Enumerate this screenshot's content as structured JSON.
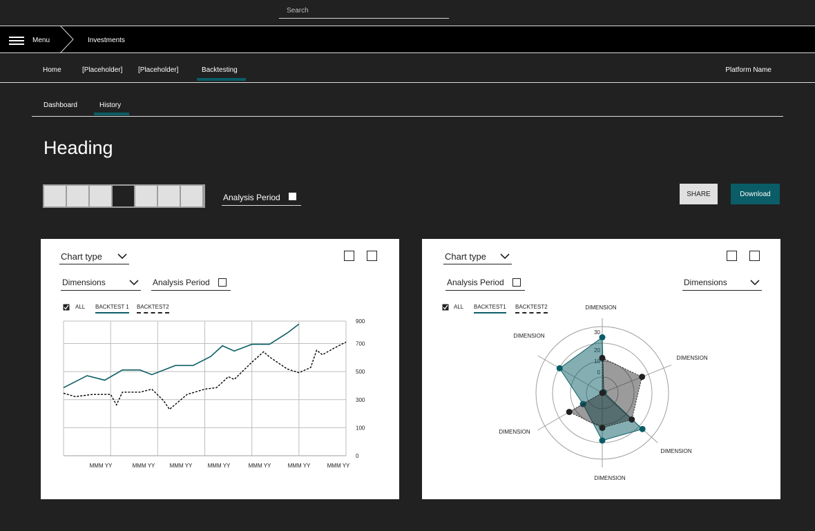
{
  "search": {
    "placeholder": "Search"
  },
  "menubar": {
    "menu_label": "Menu",
    "breadcrumb": "Investments"
  },
  "topnav": {
    "items": [
      "Home",
      "[Placeholder]",
      "[Placeholder]",
      "Backtesting"
    ],
    "active": "Backtesting",
    "platform": "Platform Name"
  },
  "subtabs": {
    "items": [
      "Dashboard",
      "History"
    ],
    "active": "History"
  },
  "page": {
    "heading": "Heading"
  },
  "controls": {
    "segments": 7,
    "selected_segment": 4,
    "analysis_period": "Analysis Period",
    "share": "SHARE",
    "download": "Download"
  },
  "colors": {
    "accent": "#0a5d66",
    "background": "#212121"
  },
  "card1": {
    "chart_type": "Chart type",
    "dimensions": "Dimensions",
    "analysis_period": "Analysis Period",
    "legend": {
      "all": "ALL",
      "series1": "BACKTEST 1",
      "series2": "BACKTEST2"
    }
  },
  "card2": {
    "chart_type": "Chart type",
    "dimensions": "Dimensions",
    "analysis_period": "Analysis Period",
    "legend": {
      "all": "ALL",
      "series1": "BACKTEST1",
      "series2": "BACKTEST2"
    }
  },
  "chart_data": [
    {
      "type": "line",
      "x": [
        0,
        1,
        2,
        3,
        4,
        5,
        6,
        7,
        8,
        9,
        10,
        11,
        12,
        13,
        14,
        15,
        16,
        17,
        18,
        19,
        20,
        21,
        22,
        23,
        24,
        25,
        26
      ],
      "xtick_labels": [
        "MMM YY",
        "MMM YY",
        "MMM YY",
        "MMM YY",
        "MMM YY",
        "MMM YY",
        "MMM YY"
      ],
      "ytick_labels": [
        "0",
        "100",
        "300",
        "500",
        "700",
        "900"
      ],
      "ytick_values": [
        0,
        100,
        300,
        500,
        700,
        900
      ],
      "ylim": [
        0,
        900
      ],
      "grid": true,
      "series": [
        {
          "name": "BACKTEST 1",
          "style": "solid",
          "color": "#0a5d66",
          "points": [
            [
              0,
              455
            ],
            [
              4,
              535
            ],
            [
              7,
              505
            ],
            [
              10,
              573
            ],
            [
              13,
              573
            ],
            [
              15,
              542
            ],
            [
              19,
              603
            ],
            [
              22,
              603
            ],
            [
              25,
              663
            ],
            [
              27,
              735
            ],
            [
              29,
              700
            ],
            [
              32,
              745
            ],
            [
              35,
              745
            ],
            [
              38,
              820
            ],
            [
              40,
              880
            ]
          ]
        },
        {
          "name": "BACKTEST2",
          "style": "dashed",
          "color": "#000000",
          "points": [
            [
              0,
              418
            ],
            [
              2,
              395
            ],
            [
              5,
              410
            ],
            [
              8,
              410
            ],
            [
              9,
              340
            ],
            [
              10,
              425
            ],
            [
              13,
              425
            ],
            [
              15,
              445
            ],
            [
              17,
              368
            ],
            [
              18,
              310
            ],
            [
              21,
              410
            ],
            [
              24,
              445
            ],
            [
              26,
              455
            ],
            [
              28,
              528
            ],
            [
              29,
              510
            ],
            [
              32,
              625
            ],
            [
              34,
              695
            ],
            [
              35,
              660
            ],
            [
              38,
              580
            ],
            [
              40,
              555
            ],
            [
              42,
              590
            ],
            [
              43,
              705
            ],
            [
              44,
              675
            ],
            [
              46,
              720
            ],
            [
              48,
              760
            ]
          ]
        }
      ]
    },
    {
      "type": "radar",
      "axes": [
        "DIMENSION",
        "DIMENSION",
        "DIMENSION",
        "DIMENSION",
        "DIMENSION",
        "DIMENSION"
      ],
      "radial_ticks": [
        "0",
        "10",
        "20",
        "30"
      ],
      "series": [
        {
          "name": "BACKTEST1",
          "color": "#0a5d66",
          "values": [
            35,
            1,
            34,
            30,
            14,
            31
          ]
        },
        {
          "name": "BACKTEST2",
          "color": "#000000",
          "values": [
            22,
            27,
            25,
            22,
            24,
            0
          ]
        }
      ]
    }
  ]
}
